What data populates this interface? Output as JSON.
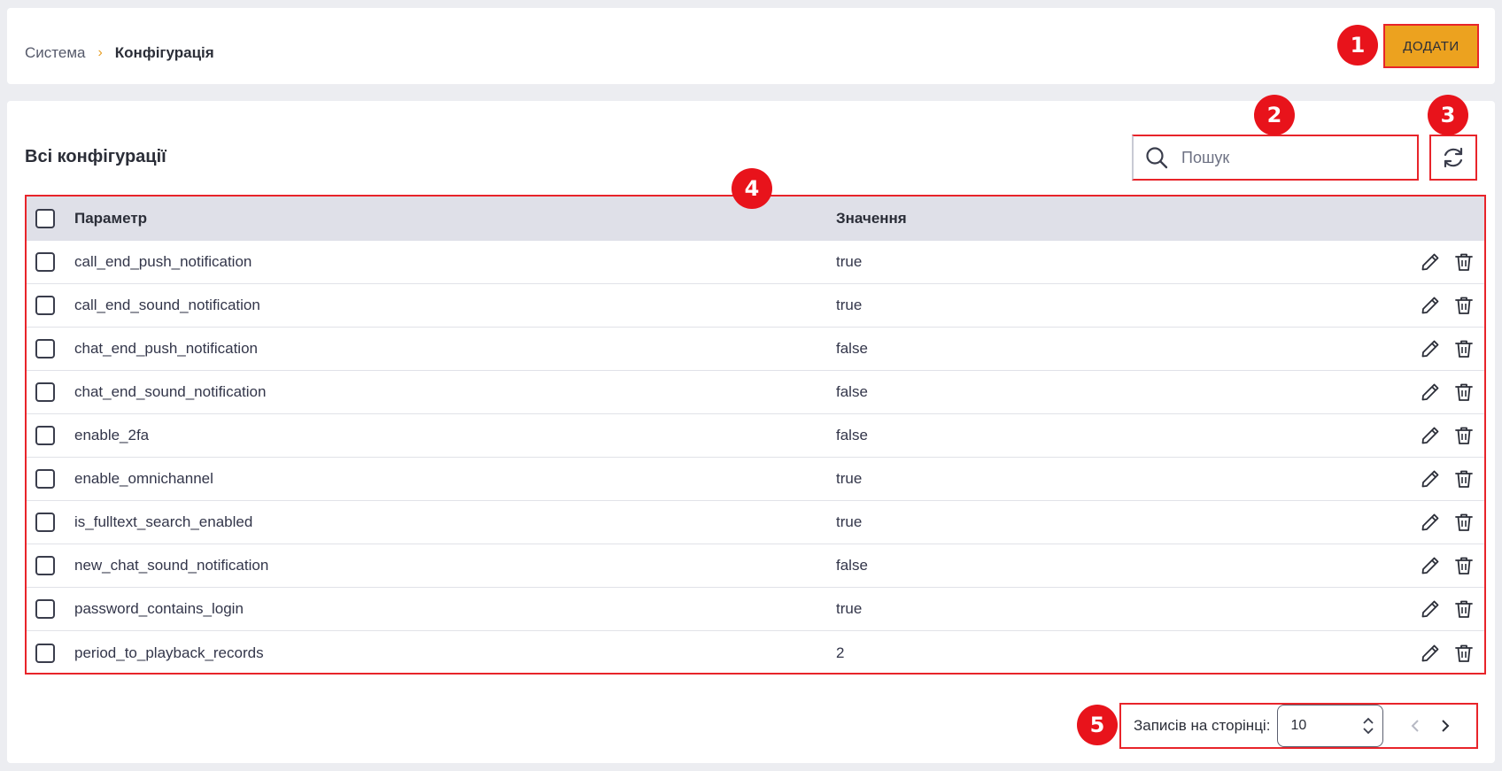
{
  "breadcrumb": {
    "root": "Система",
    "separator": "›",
    "current": "Конфігурація"
  },
  "toolbar": {
    "add_label": "ДОДАТИ"
  },
  "panel": {
    "title": "Всі конфігурації",
    "search_placeholder": "Пошук"
  },
  "table": {
    "columns": [
      "Параметр",
      "Значення"
    ],
    "rows": [
      {
        "param": "call_end_push_notification",
        "value": "true"
      },
      {
        "param": "call_end_sound_notification",
        "value": "true"
      },
      {
        "param": "chat_end_push_notification",
        "value": "false"
      },
      {
        "param": "chat_end_sound_notification",
        "value": "false"
      },
      {
        "param": "enable_2fa",
        "value": "false"
      },
      {
        "param": "enable_omnichannel",
        "value": "true"
      },
      {
        "param": "is_fulltext_search_enabled",
        "value": "true"
      },
      {
        "param": "new_chat_sound_notification",
        "value": "false"
      },
      {
        "param": "password_contains_login",
        "value": "true"
      },
      {
        "param": "period_to_playback_records",
        "value": "2"
      }
    ]
  },
  "pagination": {
    "label": "Записів на сторінці:",
    "per_page": "10"
  },
  "annotations": [
    "1",
    "2",
    "3",
    "4",
    "5"
  ],
  "colors": {
    "accent": "#eca21f",
    "highlight": "#e8242a",
    "header_bg": "#dfe0e8"
  }
}
